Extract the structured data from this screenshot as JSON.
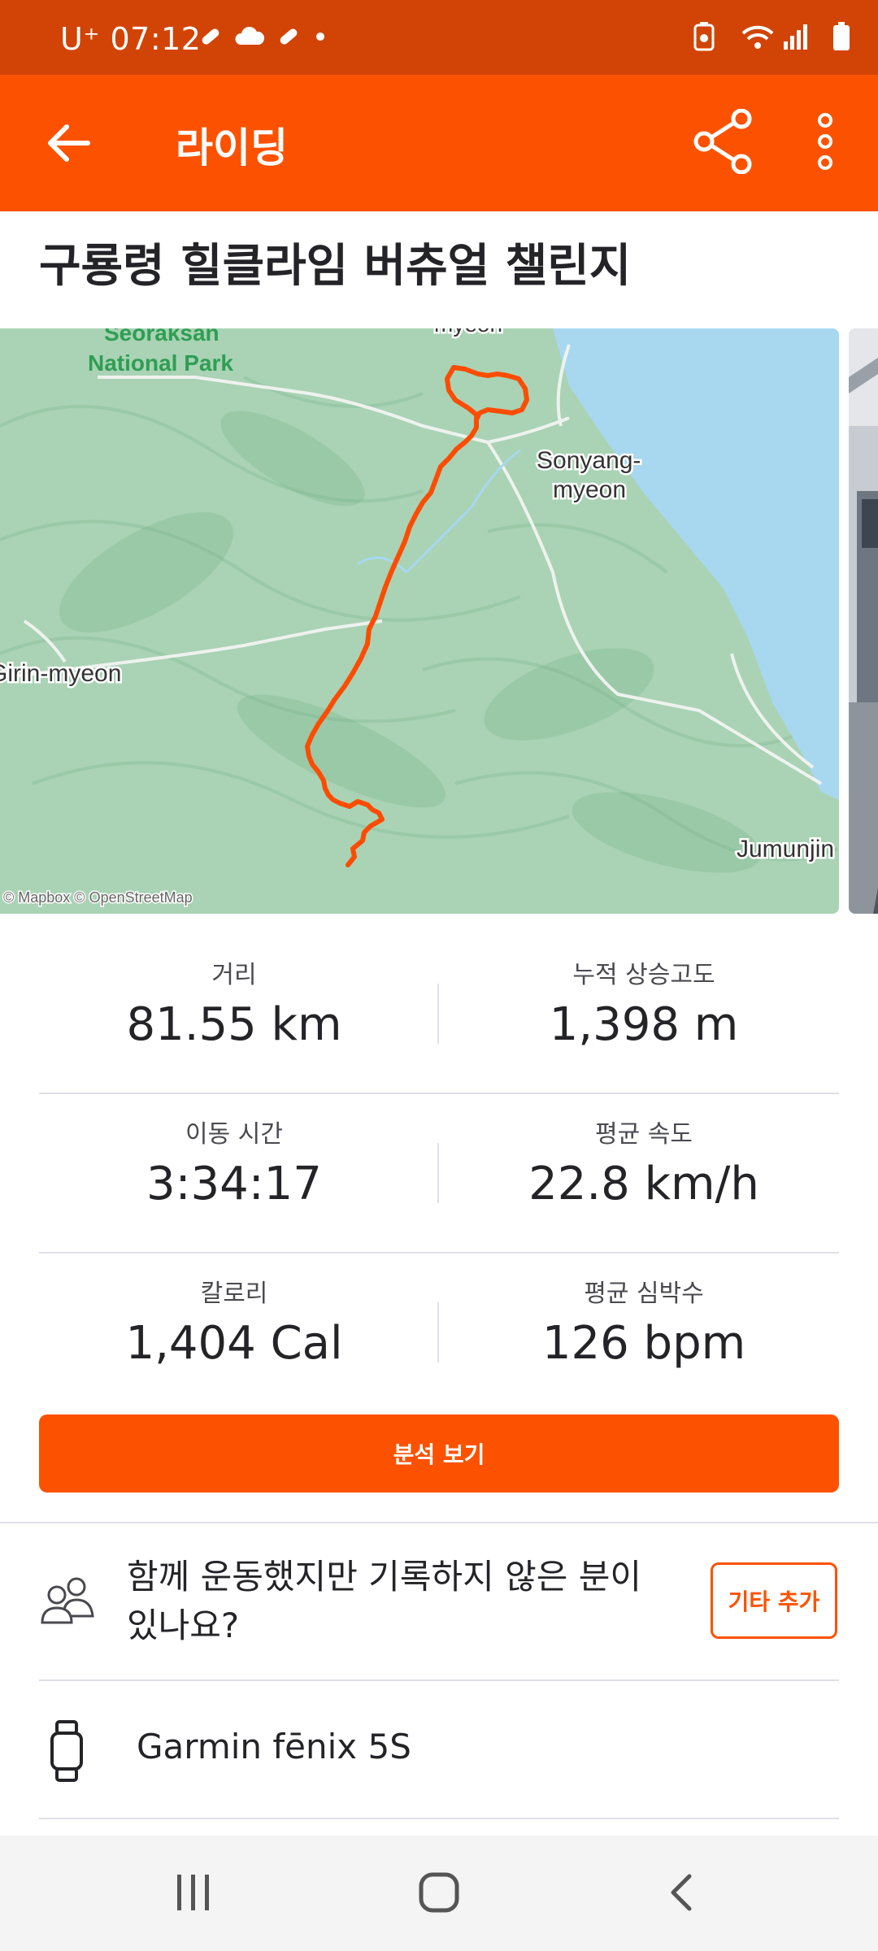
{
  "status_bar": {
    "carrier": "U⁺",
    "time": "07:12"
  },
  "app_bar": {
    "title": "라이딩",
    "back_icon": "arrow-left-icon",
    "share_icon": "share-icon",
    "more_icon": "more-vertical-icon"
  },
  "activity": {
    "title": "구룡령 힐클라임 버츄얼 챌린지"
  },
  "map": {
    "labels": {
      "park_line1": "Seoraksan",
      "park_line2": "National Park",
      "town_top": "myeon",
      "sonyang_line1": "Sonyang-",
      "sonyang_line2": "myeon",
      "girin": "Girin-myeon",
      "jumunjin": "Jumunjin",
      "attribution": "© Mapbox © OpenStreetMap"
    },
    "route_color": "#fc4c02",
    "land_color": "#a9d3b4",
    "water_color": "#a8d8f0"
  },
  "stats": [
    {
      "label": "거리",
      "value": "81.55 km"
    },
    {
      "label": "누적 상승고도",
      "value": "1,398 m"
    },
    {
      "label": "이동 시간",
      "value": "3:34:17"
    },
    {
      "label": "평균 속도",
      "value": "22.8 km/h"
    },
    {
      "label": "칼로리",
      "value": "1,404 Cal"
    },
    {
      "label": "평균 심박수",
      "value": "126 bpm"
    }
  ],
  "analysis_button": "분석 보기",
  "together": {
    "text": "함께 운동했지만 기록하지 않은 분이 있나요?",
    "button": "기타 추가"
  },
  "device": {
    "name": "Garmin fēnix 5S"
  },
  "colors": {
    "brand": "#fc5200",
    "status_bar": "#d24406"
  }
}
